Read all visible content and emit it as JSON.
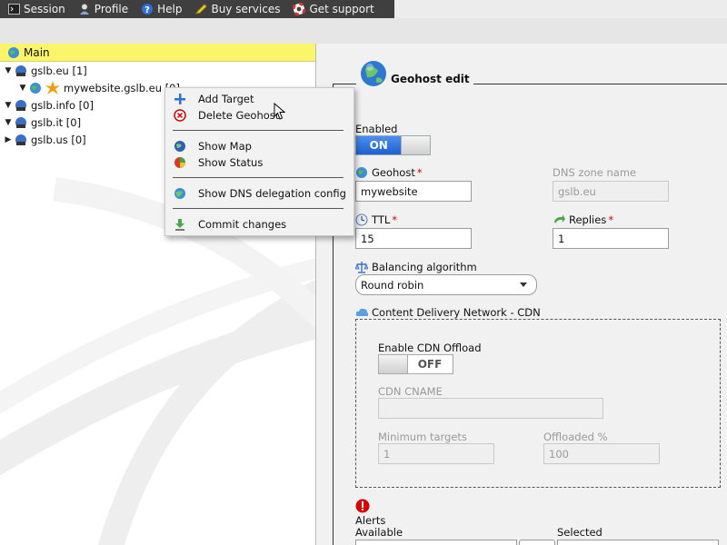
{
  "topbar": {
    "items": [
      {
        "label": "Session",
        "icon": "terminal-icon"
      },
      {
        "label": "Profile",
        "icon": "user-icon"
      },
      {
        "label": "Help",
        "icon": "help-icon"
      },
      {
        "label": "Buy services",
        "icon": "pencil-icon"
      },
      {
        "label": "Get support",
        "icon": "lifebuoy-icon"
      }
    ]
  },
  "tree": {
    "header": "Main",
    "nodes": [
      {
        "label": "gslb.eu [1]",
        "expanded": true
      },
      {
        "label": "mywebsite.gslb.eu [0]",
        "selected": true
      },
      {
        "label": "gslb.info [0]",
        "expanded": true
      },
      {
        "label": "gslb.it [0]",
        "expanded": true
      },
      {
        "label": "gslb.us [0]",
        "expanded": false
      }
    ]
  },
  "context_menu": {
    "items": [
      {
        "label": "Add Target",
        "icon": "plus-icon"
      },
      {
        "label": "Delete Geohost",
        "icon": "delete-icon"
      },
      {
        "label": "Show Map",
        "icon": "globe-icon"
      },
      {
        "label": "Show Status",
        "icon": "status-icon"
      },
      {
        "label": "Show DNS delegation config",
        "icon": "dns-globe-icon"
      },
      {
        "label": "Commit changes",
        "icon": "commit-icon"
      }
    ]
  },
  "form": {
    "title": "Geohost edit",
    "enabled": {
      "label": "Enabled",
      "state": "ON"
    },
    "geohost": {
      "label": "Geohost",
      "value": "mywebsite"
    },
    "dns_zone": {
      "label": "DNS zone name",
      "value": "gslb.eu"
    },
    "ttl": {
      "label": "TTL",
      "value": "15"
    },
    "replies": {
      "label": "Replies",
      "value": "1"
    },
    "balancing": {
      "label": "Balancing algorithm",
      "value": "Round robin"
    },
    "cdn": {
      "legend": "Content Delivery Network - CDN",
      "offload_label": "Enable CDN Offload",
      "offload_state": "OFF",
      "cname_label": "CDN CNAME",
      "cname_value": "",
      "min_targets_label": "Minimum targets",
      "min_targets_value": "1",
      "offloaded_label": "Offloaded %",
      "offloaded_value": "100"
    },
    "alerts": {
      "label": "Alerts",
      "available": "Available",
      "selected": "Selected"
    }
  },
  "colors": {
    "topbar": "#3f3f3f",
    "tree_header": "#fbf56a",
    "toggle_on": "#2a6de0",
    "required": "#d40000"
  }
}
